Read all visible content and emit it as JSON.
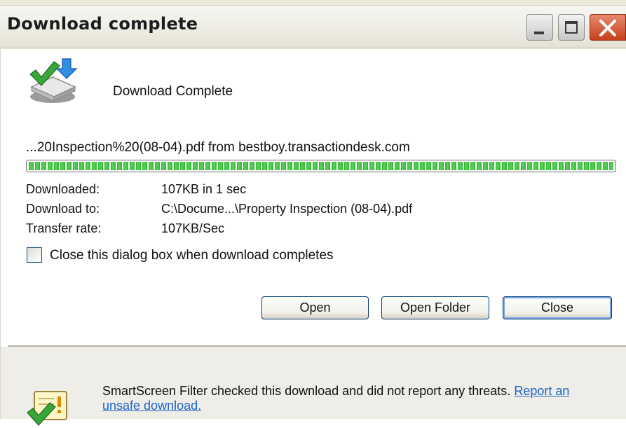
{
  "window": {
    "title": "Download complete",
    "controls": {
      "minimize": "minimize-icon",
      "maximize": "maximize-icon",
      "close": "close-icon"
    }
  },
  "header": {
    "icon": "download-complete-icon",
    "heading": "Download Complete"
  },
  "file": {
    "description": "...20Inspection%20(08-04).pdf from bestboy.transactiondesk.com"
  },
  "progress": {
    "percent": 100,
    "color": "#2fb62f"
  },
  "details": [
    {
      "label": "Downloaded:",
      "value": "107KB in 1 sec"
    },
    {
      "label": "Download to:",
      "value": "C:\\Docume...\\Property Inspection (08-04).pdf"
    },
    {
      "label": "Transfer rate:",
      "value": "107KB/Sec"
    }
  ],
  "options": {
    "close_when_complete": {
      "label": "Close this dialog box when download completes",
      "checked": false
    }
  },
  "buttons": {
    "open": "Open",
    "open_folder": "Open Folder",
    "close": "Close"
  },
  "smartscreen": {
    "icon": "smartscreen-check-icon",
    "text": "SmartScreen Filter checked this download and did not report any threats.",
    "link": "Report an unsafe download."
  }
}
